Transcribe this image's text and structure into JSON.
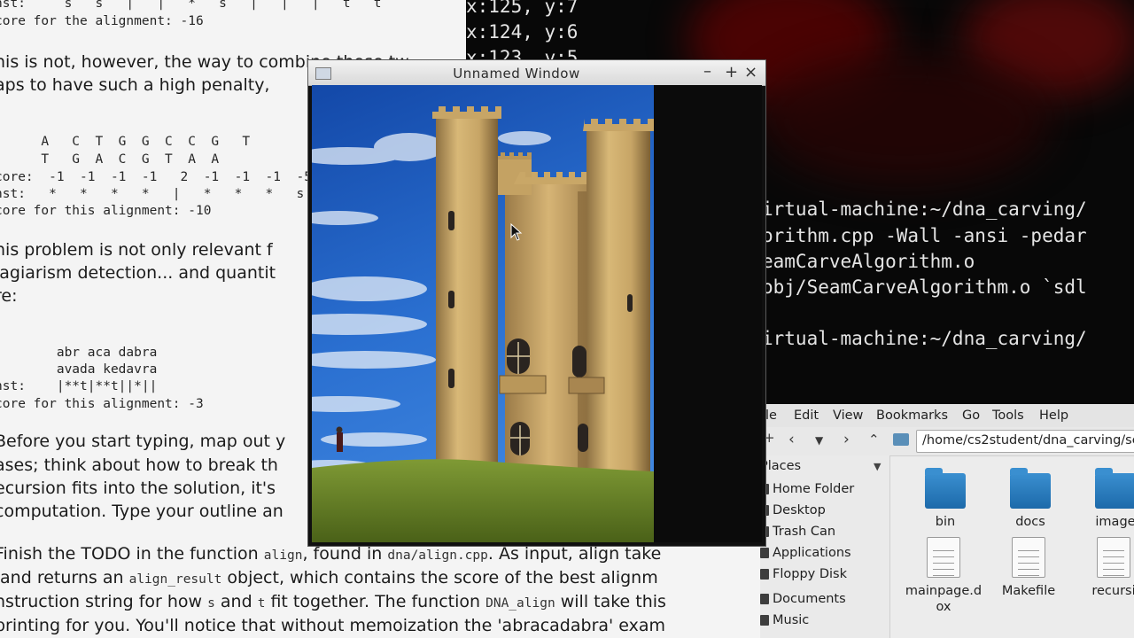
{
  "document": {
    "lines": [
      {
        "text": "nst:     s   s   |   |   *   s   |   |   |   t   t",
        "mono": true
      },
      {
        "text": "core for the alignment: -16",
        "mono": true
      },
      {
        "text": "his is not, however, the way to combine these tw",
        "mono": false
      },
      {
        "text": "aps to have such a high penalty,",
        "mono": false
      },
      {
        "text": "      A   C  T  G  G  C  C  G   T",
        "mono": true
      },
      {
        "text": "      T   G  A  C  G  T  A  A",
        "mono": true
      },
      {
        "text": "core:  -1  -1  -1  -1   2  -1  -1  -1  -5",
        "mono": true
      },
      {
        "text": "nst:   *   *   *   *   |   *   *   *   s",
        "mono": true
      },
      {
        "text": "core for this alignment: -10",
        "mono": true
      },
      {
        "text": "his problem is not only relevant f",
        "mono": false
      },
      {
        "text": "lagiarism detection... and quantit",
        "mono": false
      },
      {
        "text": "re:",
        "mono": false
      },
      {
        "text": ":       abr aca dabra",
        "mono": true
      },
      {
        "text": ":       avada kedavra",
        "mono": true
      },
      {
        "text": "nst:    |**t|**t||*||",
        "mono": true
      },
      {
        "text": "core for this alignment: -3",
        "mono": true
      },
      {
        "text": "Before you start typing, map out y",
        "mono": false
      },
      {
        "text": "ases; think about how to break th",
        "mono": false
      },
      {
        "text": "ecursion fits into the solution, it's",
        "mono": false
      },
      {
        "text": "computation. Type your outline an",
        "mono": false
      }
    ],
    "lower": {
      "l1a": "Finish the TODO in the function ",
      "l1code1": "align",
      "l1b": ", found in ",
      "l1code2": "dna/align.cpp",
      "l1c": ". As input, align take",
      "l2a": " and returns an ",
      "l2code": "align_result",
      "l2b": " object, which contains the score of the best alignm",
      "l3a": "nstruction string for how ",
      "l3code1": "s",
      "l3b": " and ",
      "l3code2": "t",
      "l3c": " fit together. The function ",
      "l3code3": "DNA_align",
      "l3d": " will take this",
      "l4": "printing for you. You'll notice that without memoization the 'abracadabra' exam"
    }
  },
  "terminal": {
    "lines": [
      "x:125, y:7",
      "x:124, y:6",
      "x:123, y:5",
      "irtual-machine:~/dna_carving/",
      "orithm.cpp -Wall -ansi -pedar",
      "eamCarveAlgorithm.o",
      "obj/SeamCarveAlgorithm.o `sdl",
      "irtual-machine:~/dna_carving/"
    ]
  },
  "image_window": {
    "title": "Unnamed Window",
    "minimize": "–",
    "maximize": "+",
    "close": "×"
  },
  "file_manager": {
    "menu": [
      "ile",
      "Edit",
      "View",
      "Bookmarks",
      "Go",
      "Tools",
      "Help"
    ],
    "path": "/home/cs2student/dna_carving/se",
    "sidebar_header": "Places",
    "places": [
      "Home Folder",
      "Desktop",
      "Trash Can",
      "Applications",
      "Floppy Disk",
      "Documents",
      "Music"
    ],
    "files": [
      {
        "name": "bin",
        "kind": "folder"
      },
      {
        "name": "docs",
        "kind": "folder"
      },
      {
        "name": "image",
        "kind": "folder"
      },
      {
        "name": "mainpage.d ox",
        "kind": "file"
      },
      {
        "name": "Makefile",
        "kind": "file"
      },
      {
        "name": "recursi",
        "kind": "file"
      }
    ]
  },
  "colors": {
    "sky": "#1f5fc4",
    "stone": "#c9a767",
    "grass": "#5f7a25",
    "folder": "#2b7fc4"
  }
}
